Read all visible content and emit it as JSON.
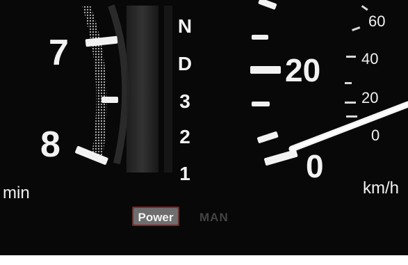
{
  "tachometer": {
    "numerals": [
      "7",
      "8"
    ],
    "unit": "min"
  },
  "gear_selector": {
    "positions": [
      "N",
      "D",
      "3",
      "2",
      "1"
    ]
  },
  "speedometer": {
    "major_numerals": [
      "20",
      "0"
    ],
    "small_numerals": [
      "60",
      "40",
      "20",
      "0"
    ],
    "unit": "km/h"
  },
  "mode_indicators": {
    "active_label": "Power",
    "inactive_label": "MAN"
  },
  "colors": {
    "background": "#080808",
    "glyph": "#f2f2f2",
    "power_badge": "#c94a4a",
    "man_dim": "#444444"
  }
}
